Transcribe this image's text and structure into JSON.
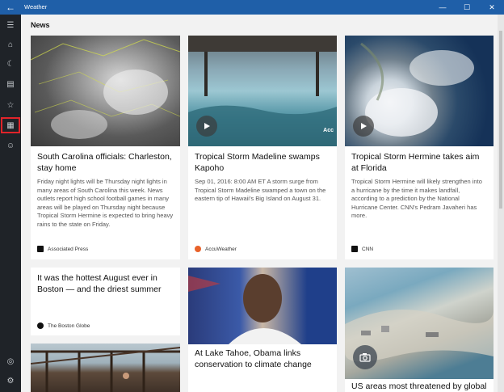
{
  "window": {
    "title": "Weather",
    "back_glyph": "←",
    "minimize_glyph": "—",
    "maximize_glyph": "☐",
    "close_glyph": "✕"
  },
  "sidebar": {
    "items": [
      {
        "icon": "hamburger-icon",
        "glyph": "☰"
      },
      {
        "icon": "home-icon",
        "glyph": "⌂"
      },
      {
        "icon": "moon-icon",
        "glyph": "☾"
      },
      {
        "icon": "chart-icon",
        "glyph": "▤"
      },
      {
        "icon": "star-list-icon",
        "glyph": "☆"
      },
      {
        "icon": "news-icon",
        "glyph": "▦"
      },
      {
        "icon": "smiley-icon",
        "glyph": "☺"
      },
      {
        "icon": "account-icon",
        "glyph": "◎"
      },
      {
        "icon": "gear-icon",
        "glyph": "⚙"
      }
    ],
    "selected": "news-icon"
  },
  "page": {
    "title": "News"
  },
  "articles": [
    {
      "headline": "South Carolina officials: Charleston, stay home",
      "summary": "Friday night lights will be Thursday night lights in many areas of South Carolina this week. News outlets report high school football games in many areas will be played on Thursday night because Tropical Storm Hermine is expected to bring heavy rains to the state on Friday.",
      "source": "Associated Press",
      "source_color": "#111111",
      "image": "radar-map",
      "media": "none"
    },
    {
      "headline": "Tropical Storm Madeline swamps Kapoho",
      "summary": "Sep 01, 2016: 8:00 AM ET A storm surge from Tropical Storm Madeline swamped a town on the eastern tip of Hawaii's Big Island on August 31.",
      "source": "AccuWeather",
      "source_color": "#e8622a",
      "image": "storm-surge",
      "media": "video",
      "overlay_text": "Acc"
    },
    {
      "headline": "Tropical Storm Hermine takes aim at Florida",
      "summary": "Tropical Storm Hermine will likely strengthen into a hurricane by the time it makes landfall, according to a prediction by the National Hurricane Center. CNN's Pedram Javaheri has more.",
      "source": "CNN",
      "source_color": "#111111",
      "image": "satellite-storm",
      "media": "video"
    },
    {
      "headline": "It was the hottest August ever in Boston — and the driest summer",
      "source": "The Boston Globe",
      "source_color": "#111111"
    },
    {
      "headline": "At Lake Tahoe, Obama links conservation to climate change",
      "image": "obama-photo"
    },
    {
      "headline": "US areas most threatened by global",
      "image": "coastal-city",
      "media": "gallery"
    },
    {
      "image": "pier-photo"
    }
  ]
}
